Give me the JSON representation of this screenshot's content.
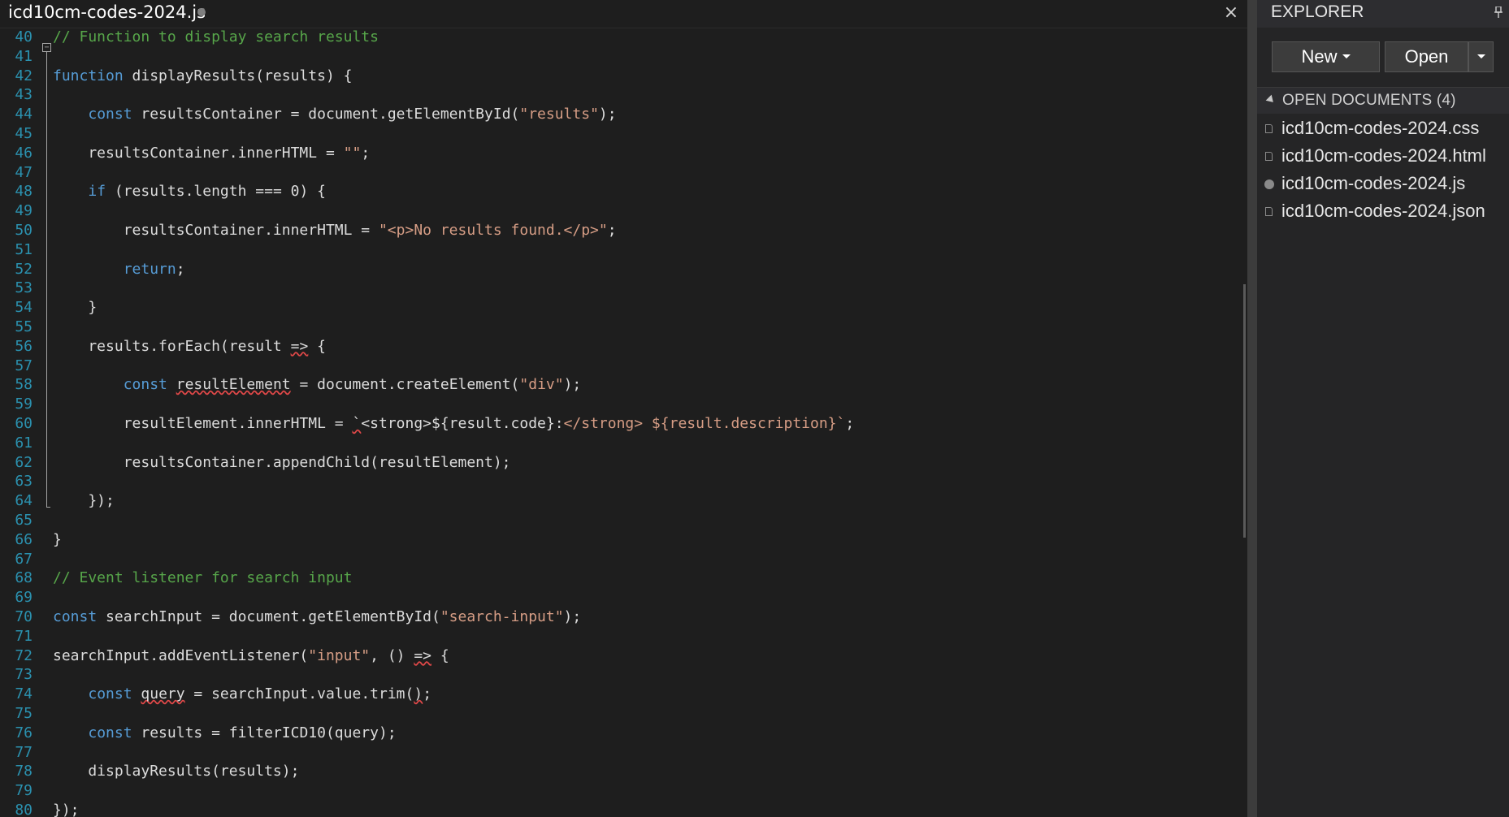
{
  "editor": {
    "tab_title": "icd10cm-codes-2024.js",
    "tab_close": "×",
    "lines": [
      {
        "n": "40",
        "html": "<span class=\"cm\">// Function to display search results</span>"
      },
      {
        "n": "41",
        "html": ""
      },
      {
        "n": "42",
        "html": "<span class=\"kw\">function</span> displayResults(results) {"
      },
      {
        "n": "43",
        "html": ""
      },
      {
        "n": "44",
        "html": "    <span class=\"kw\">const</span> resultsContainer = document.getElementById(<span class=\"str\">\"results\"</span>);"
      },
      {
        "n": "45",
        "html": ""
      },
      {
        "n": "46",
        "html": "    resultsContainer.innerHTML = <span class=\"str\">\"\"</span>;"
      },
      {
        "n": "47",
        "html": ""
      },
      {
        "n": "48",
        "html": "    <span class=\"kw\">if</span> (results.length === 0) {"
      },
      {
        "n": "49",
        "html": ""
      },
      {
        "n": "50",
        "html": "        resultsContainer.innerHTML = <span class=\"str\">\"&lt;p&gt;No results found.&lt;/p&gt;\"</span>;"
      },
      {
        "n": "51",
        "html": ""
      },
      {
        "n": "52",
        "html": "        <span class=\"kw\">return</span>;"
      },
      {
        "n": "53",
        "html": ""
      },
      {
        "n": "54",
        "html": "    }"
      },
      {
        "n": "55",
        "html": ""
      },
      {
        "n": "56",
        "html": "    results.forEach(result <span class=\"sq\">=&gt;</span> {"
      },
      {
        "n": "57",
        "html": ""
      },
      {
        "n": "58",
        "html": "        <span class=\"kw\">const</span> <span class=\"sq\">resultElement</span> = document.createElement(<span class=\"str\">\"div\"</span>);"
      },
      {
        "n": "59",
        "html": ""
      },
      {
        "n": "60",
        "html": "        resultElement.innerHTML = <span class=\"sq\">`</span>&lt;strong&gt;${result.code}:<span class=\"str\">&lt;/strong&gt; ${result.description}`</span>;"
      },
      {
        "n": "61",
        "html": ""
      },
      {
        "n": "62",
        "html": "        resultsContainer.appendChild(resultElement);"
      },
      {
        "n": "63",
        "html": ""
      },
      {
        "n": "64",
        "html": "    });"
      },
      {
        "n": "65",
        "html": ""
      },
      {
        "n": "66",
        "html": "}"
      },
      {
        "n": "67",
        "html": ""
      },
      {
        "n": "68",
        "html": "<span class=\"cm\">// Event listener for search input</span>"
      },
      {
        "n": "69",
        "html": ""
      },
      {
        "n": "70",
        "html": "<span class=\"kw\">const</span> searchInput = document.getElementById(<span class=\"str\">\"search-input\"</span>);"
      },
      {
        "n": "71",
        "html": ""
      },
      {
        "n": "72",
        "html": "searchInput.addEventListener(<span class=\"str\">\"input\"</span>, () <span class=\"sq\">=&gt;</span> {"
      },
      {
        "n": "73",
        "html": ""
      },
      {
        "n": "74",
        "html": "    <span class=\"kw\">const</span> <span class=\"sq\">query</span> = searchInput.value.trim(<span class=\"sq\">)</span>;"
      },
      {
        "n": "75",
        "html": ""
      },
      {
        "n": "76",
        "html": "    <span class=\"kw\">const</span> results = filterICD10(query);"
      },
      {
        "n": "77",
        "html": ""
      },
      {
        "n": "78",
        "html": "    displayResults(results);"
      },
      {
        "n": "79",
        "html": ""
      },
      {
        "n": "80",
        "html": "});"
      }
    ]
  },
  "explorer": {
    "title": "EXPLORER",
    "new_button": "New",
    "open_button": "Open",
    "section_label": "OPEN DOCUMENTS (4)",
    "documents": [
      {
        "name": "icd10cm-codes-2024.css",
        "icon": "file-icon"
      },
      {
        "name": "icd10cm-codes-2024.html",
        "icon": "file-icon"
      },
      {
        "name": "icd10cm-codes-2024.js",
        "icon": "unsaved-dot-icon"
      },
      {
        "name": "icd10cm-codes-2024.json",
        "icon": "file-icon"
      }
    ]
  },
  "colors": {
    "background": "#1e1e1e",
    "keyword": "#569cd6",
    "string": "#d69d85",
    "comment": "#57a64a",
    "line_number": "#2b91af"
  }
}
